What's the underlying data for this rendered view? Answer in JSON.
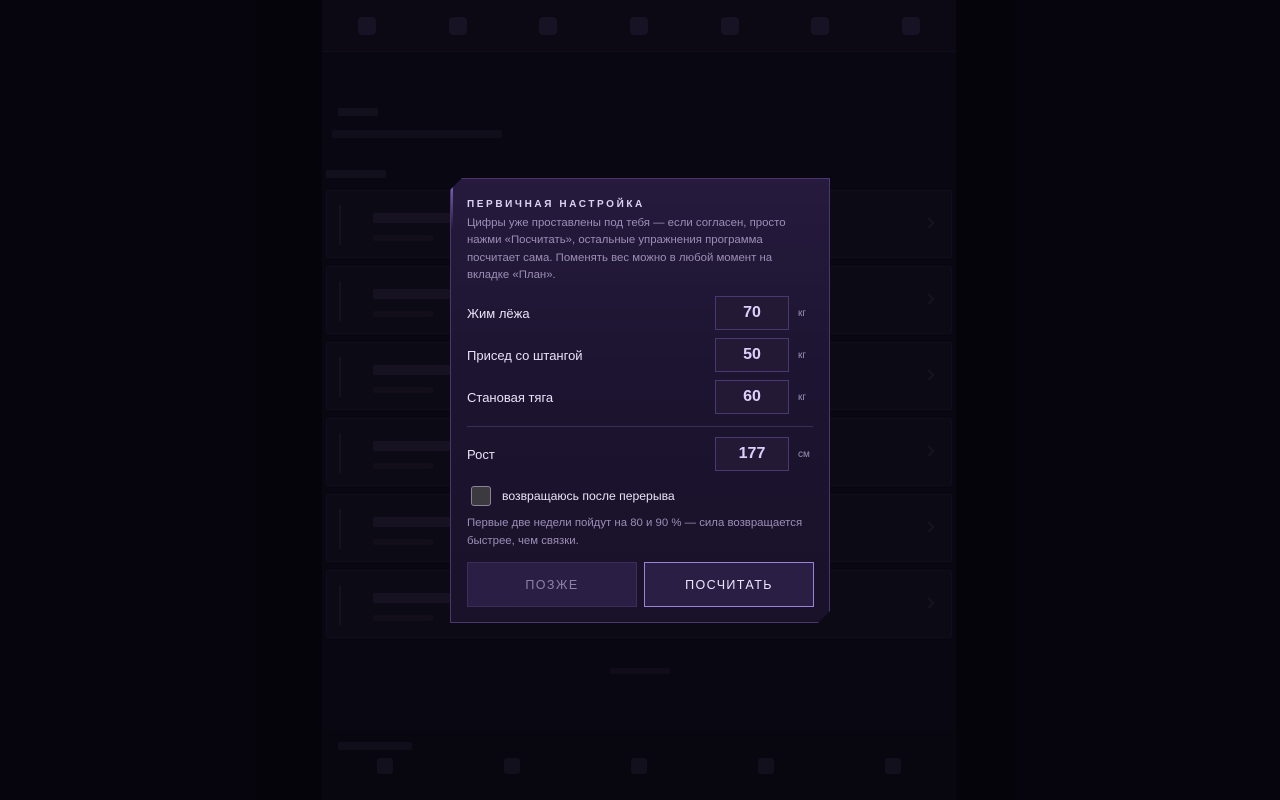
{
  "modal": {
    "heading": "ПЕРВИЧНАЯ НАСТРОЙКА",
    "intro": "Цифры уже проставлены под тебя — если согласен, просто нажми «Посчитать», остальные упражнения программа посчитает сама. Поменять вес можно в любой момент на вкладке «План».",
    "fields": [
      {
        "label": "Жим лёжа",
        "value": "70",
        "unit": "кг"
      },
      {
        "label": "Присед со штангой",
        "value": "50",
        "unit": "кг"
      },
      {
        "label": "Становая тяга",
        "value": "60",
        "unit": "кг"
      }
    ],
    "height_field": {
      "label": "Рост",
      "value": "177",
      "unit": "см"
    },
    "checkbox": {
      "label": "возвращаюсь после перерыва",
      "checked": false
    },
    "note": "Первые две недели пойдут на 80 и 90 % — сила возвращается быстрее, чем связки.",
    "buttons": {
      "later": "ПОЗЖЕ",
      "calculate": "ПОСЧИТАТЬ"
    }
  },
  "colors": {
    "accent": "#9c82d6",
    "modal_bg": "#1c1430",
    "text_primary": "#e8e0f6",
    "text_muted": "#9c8db6"
  }
}
